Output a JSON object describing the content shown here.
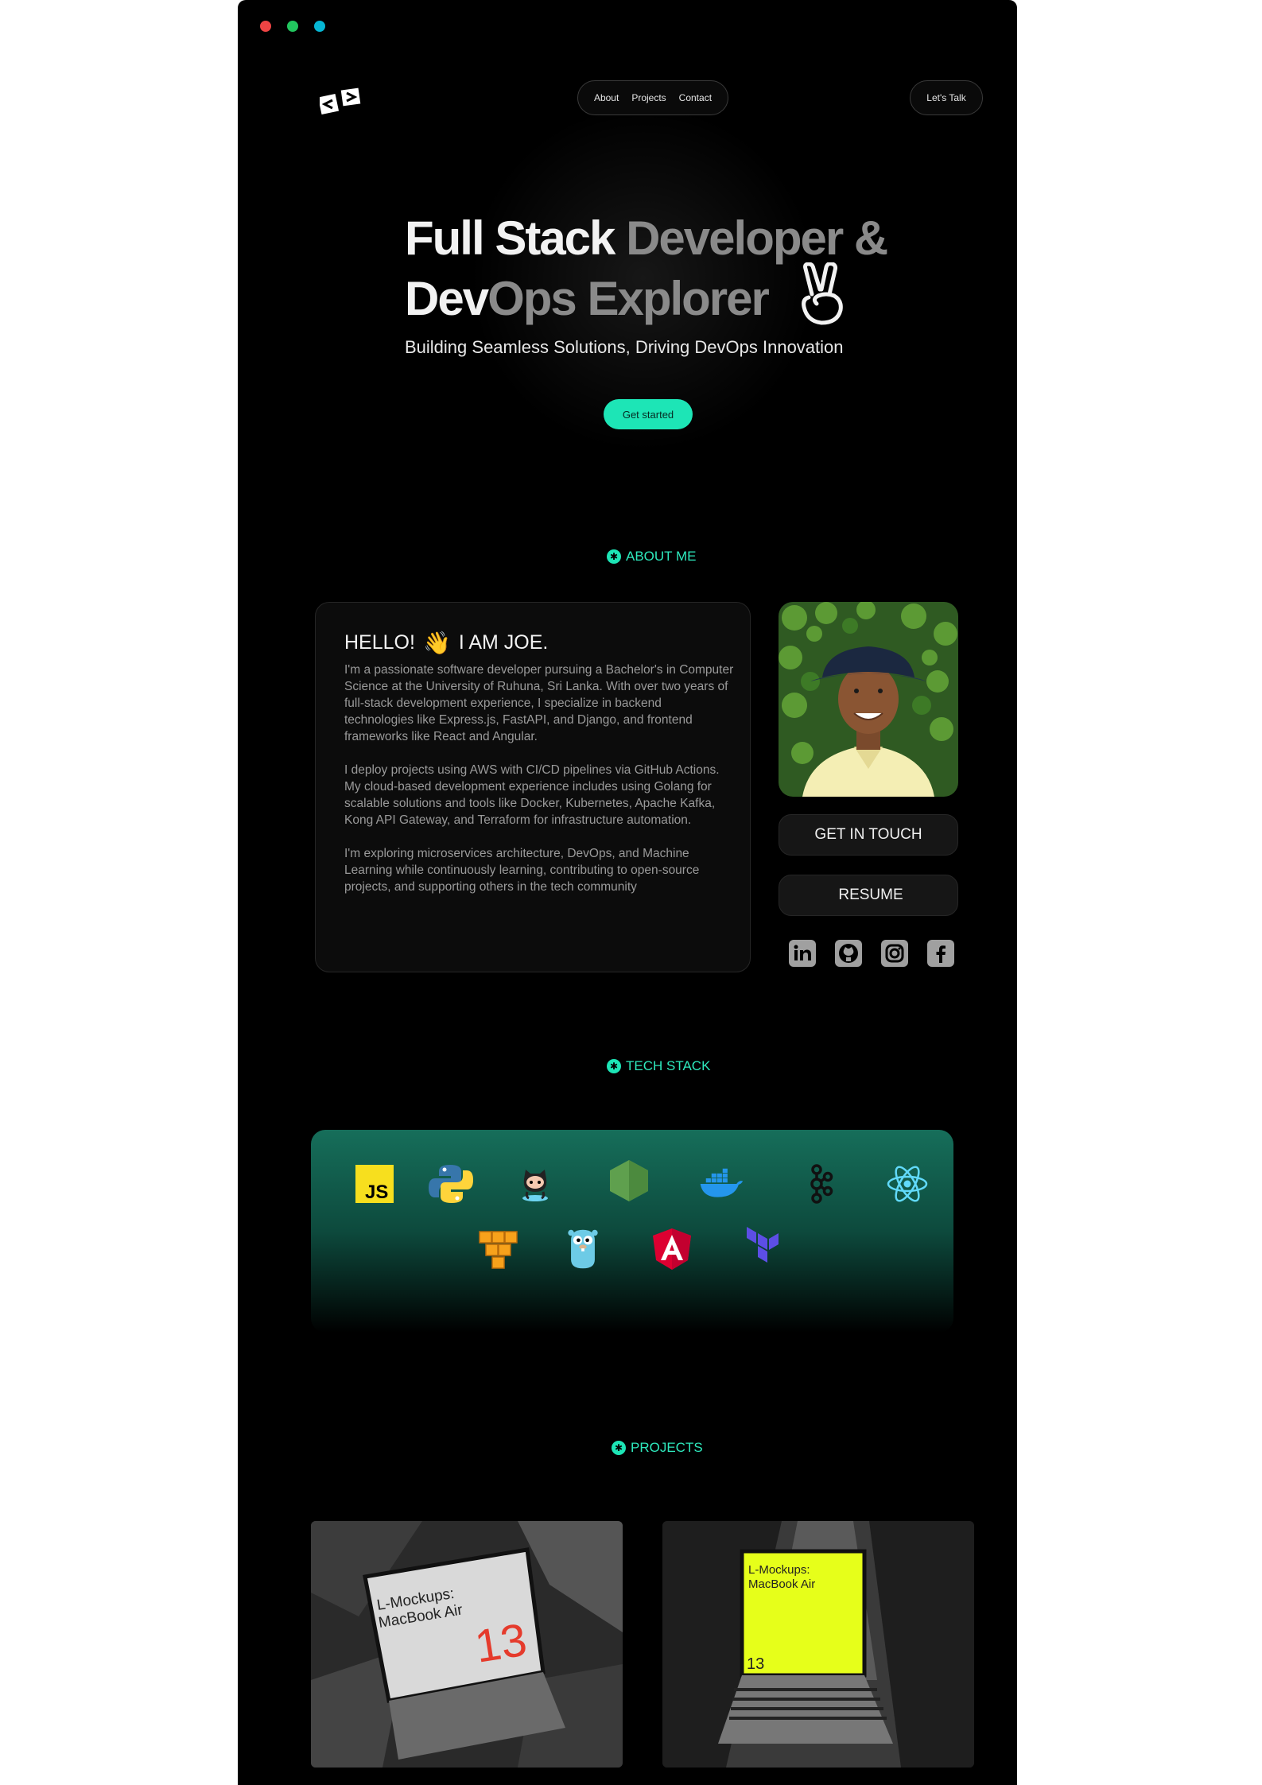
{
  "window": {
    "dots": [
      "#ef4444",
      "#22c55e",
      "#06b6d4"
    ]
  },
  "header": {
    "nav": [
      "About",
      "Projects",
      "Contact"
    ],
    "talk_label": "Let's Talk"
  },
  "hero": {
    "title_words_bright": [
      "Full",
      "Stack"
    ],
    "title_words_dim": [
      "Developer",
      "&"
    ],
    "title_line2_bright": "Dev",
    "title_line2_dim": "Ops Explorer",
    "subtitle": "Building Seamless Solutions, Driving DevOps Innovation",
    "cta": "Get started"
  },
  "sections": {
    "about": "ABOUT ME",
    "tech": "TECH STACK",
    "projects": "PROJECTS"
  },
  "about": {
    "greeting_a": "HELLO!",
    "greeting_b": "I AM JOE.",
    "paragraphs": [
      "I'm a passionate software developer pursuing a Bachelor's in Computer Science at the University of Ruhuna, Sri Lanka. With over two years of full-stack development experience, I specialize in backend technologies like Express.js, FastAPI, and Django, and frontend frameworks like React and Angular.",
      "I deploy projects using AWS with CI/CD pipelines via GitHub Actions. My cloud-based development experience includes using Golang for scalable solutions and tools like Docker, Kubernetes, Apache Kafka, Kong API Gateway, and Terraform for infrastructure automation.",
      "I'm exploring microservices architecture, DevOps, and Machine Learning while continuously learning, contributing to open-source projects, and supporting others in the tech community"
    ],
    "get_in_touch": "GET IN TOUCH",
    "resume": "RESUME"
  },
  "socials": [
    "linkedin-icon",
    "github-icon",
    "instagram-icon",
    "facebook-icon"
  ],
  "tech_icons": [
    "javascript-icon",
    "python-icon",
    "github-octocat-icon",
    "nodejs-icon",
    "docker-icon",
    "kafka-icon",
    "react-icon",
    "aws-icon",
    "golang-gopher-icon",
    "angular-icon",
    "terraform-icon"
  ],
  "projects": [
    {
      "screen_title": "L-Mockups:\nMacBook Air",
      "screen_number": "13",
      "screen_color": "#ffffff"
    },
    {
      "screen_title": "L-Mockups:\nMacBook Air",
      "screen_number": "13",
      "screen_color": "#e6ff1a"
    }
  ]
}
